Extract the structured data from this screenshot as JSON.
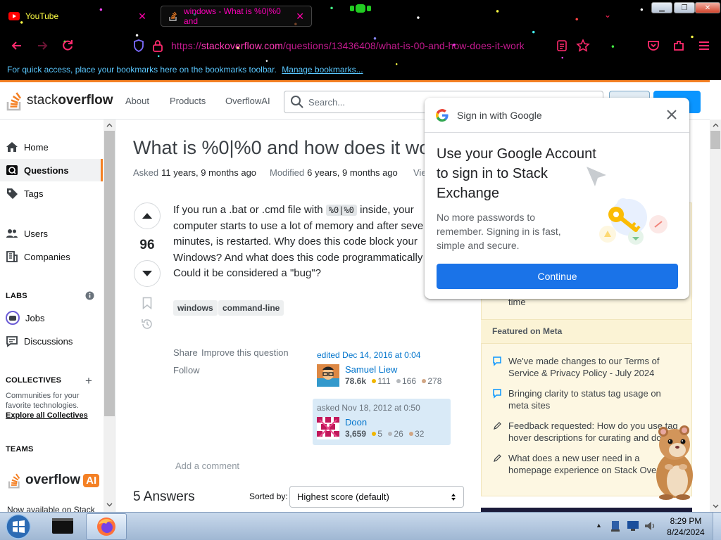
{
  "browser": {
    "tabs": [
      {
        "title": "YouTube",
        "active": false
      },
      {
        "title": "windows - What is %0|%0 and",
        "active": true
      }
    ],
    "url": {
      "scheme": "https://",
      "host": "stackoverflow.com",
      "path": "/questions/13436408/what-is-00-and-how-does-it-work"
    },
    "bookmarks_bar": {
      "message": "For quick access, place your bookmarks here on the bookmarks toolbar.",
      "link": "Manage bookmarks..."
    }
  },
  "header": {
    "logo_a": "stack",
    "logo_b": "overflow",
    "nav": [
      "About",
      "Products",
      "OverflowAI"
    ],
    "search_placeholder": "Search..."
  },
  "sidebar": {
    "items": [
      {
        "label": "Home",
        "icon": "home-icon"
      },
      {
        "label": "Questions",
        "icon": "globe-icon",
        "selected": true
      },
      {
        "label": "Tags",
        "icon": "tag-icon"
      },
      {
        "label": "Users",
        "icon": "users-icon"
      },
      {
        "label": "Companies",
        "icon": "companies-icon"
      }
    ],
    "labs_heading": "LABS",
    "labs_items": [
      {
        "label": "Jobs",
        "icon": "jobs-icon"
      },
      {
        "label": "Discussions",
        "icon": "discussions-icon"
      }
    ],
    "collectives_heading": "COLLECTIVES",
    "collectives_text": "Communities for your favorite technologies.",
    "collectives_link": "Explore all Collectives",
    "teams_heading": "TEAMS",
    "overflow_ai_a": "overflow",
    "overflow_ai_b": "AI",
    "teams_footer": "Now available on Stack"
  },
  "question": {
    "title": "What is %0|%0 and how does it wo",
    "asked_label": "Asked",
    "asked_value": "11 years, 9 months ago",
    "modified_label": "Modified",
    "modified_value": "6 years, 9 months ago",
    "viewed_label": "Vie",
    "votes": "96",
    "body_1": "If you run a .bat or .cmd file with",
    "body_code": "%0|%0",
    "body_2": "inside, your computer starts to use a lot of memory and after seve minutes, is restarted. Why does this code block your Windows? And what does this code programmatically Could it be considered a \"bug\"?",
    "tags": [
      "windows",
      "command-line"
    ],
    "share": "Share",
    "improve": "Improve this question",
    "follow": "Follow",
    "edited": {
      "when": "edited Dec 14, 2016 at 0:04",
      "name": "Samuel Liew",
      "rep": "78.6k",
      "gold": "111",
      "silver": "166",
      "bronze": "278"
    },
    "asked": {
      "when": "asked Nov 18, 2012 at 0:50",
      "name": "Doon",
      "rep": "3,659",
      "gold": "5",
      "silver": "26",
      "bronze": "32"
    },
    "add_comment": "Add a comment",
    "answers_count": "5 Answers",
    "sorted_by": "Sorted by:",
    "sort_value": "Highest score (default)"
  },
  "right_sidebar": {
    "partial_item": "time",
    "featured_meta_heading": "Featured on Meta",
    "meta_items": [
      "We've made changes to our Terms of Service & Privacy Policy - July 2024",
      "Bringing clarity to status tag usage on meta sites",
      "Feedback requested: How do you use tag hover descriptions for curating and do",
      "What does a new user need in a homepage experience on Stack Overflow?"
    ]
  },
  "google_popup": {
    "header": "Sign in with Google",
    "title": "Use your Google Account to sign in to Stack Exchange",
    "description": "No more passwords to remember. Signing in is fast, simple and secure.",
    "button": "Continue"
  },
  "taskbar": {
    "time": "8:29 PM",
    "date": "8/24/2024"
  },
  "colors": {
    "so_orange": "#f48024",
    "google_blue": "#1a73e8",
    "link_blue": "#0074cc"
  }
}
